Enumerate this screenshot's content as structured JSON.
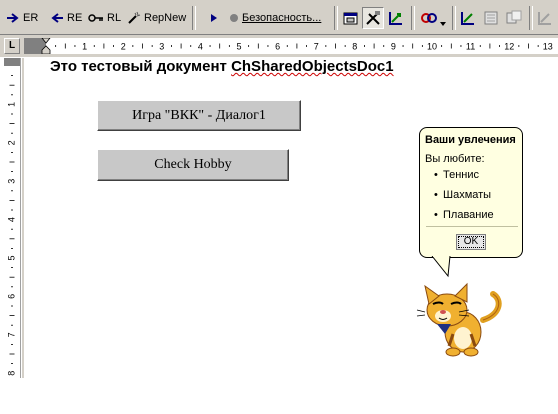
{
  "toolbar": {
    "er_label": "ER",
    "re_label": "RE",
    "rl_label": "RL",
    "repnew_label": "RepNew",
    "security_label": "Безопасность..."
  },
  "document": {
    "title_prefix": "Это тестовый документ ",
    "title_name": "ChSharedObjectsDoc1",
    "buttons": {
      "dialog": "Игра \"ВКК\" - Диалог1",
      "check_hobby": "Check Hobby"
    }
  },
  "ruler": {
    "h_numbers": [
      "1",
      "2",
      "3",
      "4",
      "5",
      "6",
      "7",
      "8",
      "9",
      "10",
      "11",
      "12",
      "13"
    ],
    "v_numbers": [
      "1",
      "2",
      "3",
      "4",
      "5",
      "6",
      "7",
      "8"
    ]
  },
  "balloon": {
    "title": "Ваши увлечения",
    "question": "Вы любите:",
    "items": [
      "Теннис",
      "Шахматы",
      "Плавание"
    ],
    "ok_label": "OK"
  },
  "colors": {
    "toolbar_bg": "#d4d0c8",
    "balloon_bg": "#ffffe1",
    "button_bg": "#c8c8c8"
  }
}
